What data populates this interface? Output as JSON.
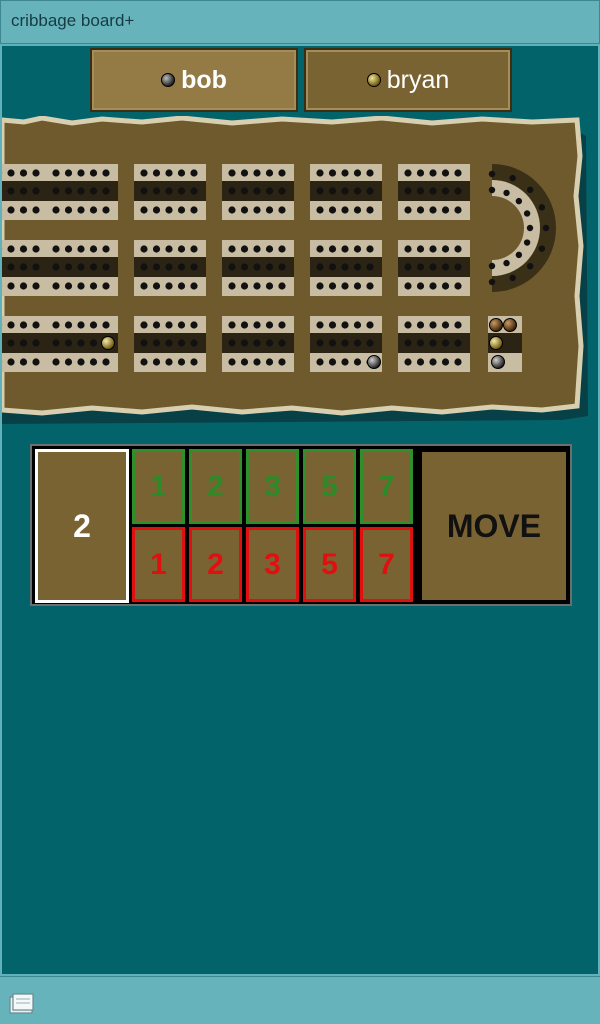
{
  "window": {
    "title": "cribbage board+"
  },
  "players": [
    {
      "name": "bob",
      "peg_color": "gray",
      "active": true
    },
    {
      "name": "bryan",
      "peg_color": "gold",
      "active": false
    }
  ],
  "board": {
    "colors": {
      "wood": "#6e5a2c",
      "rim": "#cfc6a8",
      "hole_band_light": "#c8bda2",
      "hole_band_dark": "#2b2414"
    }
  },
  "pad": {
    "count": "2",
    "green_row": [
      "1",
      "2",
      "3",
      "5",
      "7"
    ],
    "red_row": [
      "1",
      "2",
      "3",
      "5",
      "7"
    ],
    "move_label": "MOVE"
  },
  "colors": {
    "background": "#02636b",
    "chrome": "#66b3bc",
    "green": "#2d8a28",
    "red": "#e01010"
  }
}
